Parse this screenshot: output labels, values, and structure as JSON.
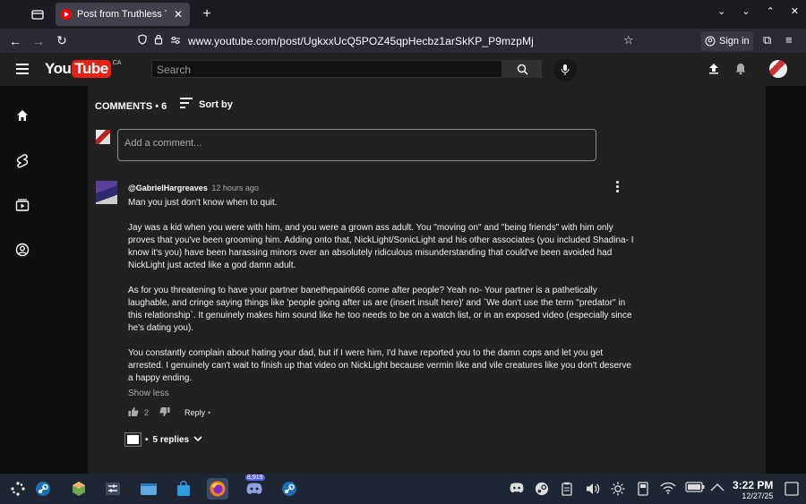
{
  "browser": {
    "tab_title": "Post from Truthless The",
    "url": "www.youtube.com/post/UgkxxUcQ5POZ45qpHecbz1arSkKP_P9mzpMj",
    "sign_in_label": "Sign in"
  },
  "youtube": {
    "logo_you": "You",
    "logo_tube": "Tube",
    "country": "CA",
    "search_placeholder": "Search"
  },
  "comments": {
    "header": "COMMENTS • 6",
    "sort_label": "Sort by",
    "add_placeholder": "Add a comment...",
    "item": {
      "author": "@GabrielHargreaves",
      "time": "12 hours ago",
      "paragraphs": [
        "Man you just don't know when to quit.",
        "Jay was a kid when you were with him, and you were a grown ass adult. You \"moving on\" and \"being friends\" with him only proves that you've been grooming him. Adding onto that, NickLight/SonicLight and his other associates (you included Shadina- I know it's you) have been harassing minors over an absolutely ridiculous misunderstanding that could've been avoided had NickLight just acted like a god damn adult.",
        "As for you threatening to have your partner banethepain666 come after people? Yeah no- Your partner is a pathetically laughable, and cringe saying things like 'people going after us are (insert insult here)' and `We don't use the term \"predator\" in this relationship`. It genuinely makes him sound like he too needs to be on a watch list, or in an exposed video (especially since he's dating you).",
        "You constantly complain about hating your dad, but if I were him, I'd have reported you to the damn cops and let you get arrested. I genuinely can't wait to finish up that video on NickLight because vermin like and vile creatures like you don't deserve a happy ending."
      ],
      "show_less": "Show less",
      "like_count": "2",
      "reply_label": "Reply",
      "reply_dot": "•",
      "replies_dot": "•",
      "replies_label": "5 replies"
    }
  },
  "taskbar": {
    "discord_badge": "8,919",
    "clock_time": "3:22 PM",
    "clock_date": "12/27/25"
  },
  "colors": {
    "accent_red": "#ff0000",
    "panel_bg": "#212121",
    "taskbar_bg": "#1e2533"
  }
}
